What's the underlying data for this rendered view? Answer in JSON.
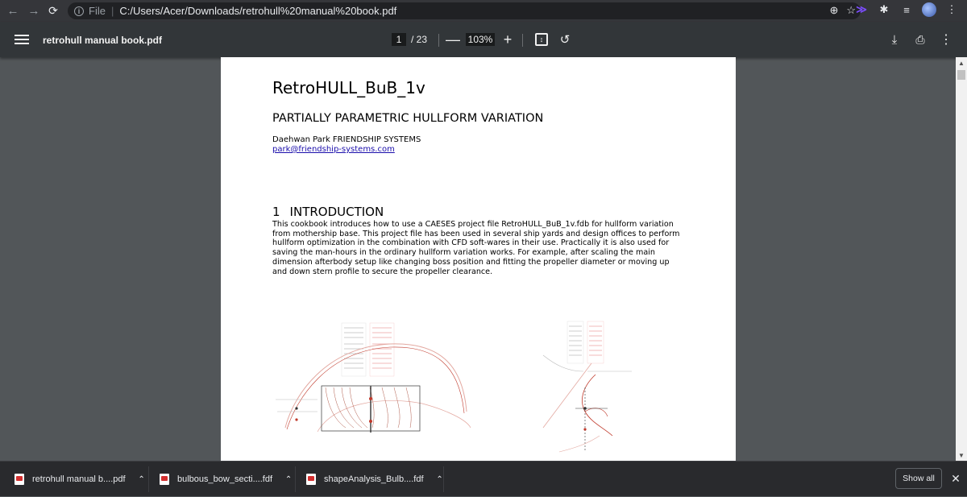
{
  "browser": {
    "url_scheme": "File",
    "url": "C:/Users/Acer/Downloads/retrohull%20manual%20book.pdf",
    "icons": [
      "back-icon",
      "forward-icon",
      "reload-icon",
      "info-icon",
      "zoom-icon",
      "star-icon",
      "extension-icon",
      "puzzle-icon",
      "playlist-icon",
      "profile-avatar",
      "kebab-menu-icon"
    ]
  },
  "pdf_toolbar": {
    "title": "retrohull manual book.pdf",
    "page_current": "1",
    "page_total": "/ 23",
    "zoom_out": "—",
    "zoom": "103%",
    "zoom_in": "+"
  },
  "document": {
    "title": "RetroHULL_BuB_1v",
    "subtitle": "PARTIALLY PARAMETRIC HULLFORM VARIATION",
    "author": "Daehwan Park FRIENDSHIP SYSTEMS",
    "email": "park@friendship-systems.com",
    "section_number": "1",
    "section_title": "INTRODUCTION",
    "intro_lines": [
      "This cookbook introduces how to use a CAESES project file RetroHULL_BuB_1v.fdb for hullform variation",
      "from mothership base. This project file has been used in several ship yards and design offices to perform",
      "hullform optimization in the combination with CFD soft-wares in their use. Practically it is also used for",
      "saving the man-hours in the ordinary hullform variation works. For example, after scaling the main",
      "dimension afterbody setup like changing boss position and fitting the propeller diameter or moving up",
      "and down stern profile to secure the propeller clearance."
    ]
  },
  "downloads": {
    "items": [
      {
        "label": "retrohull manual b....pdf"
      },
      {
        "label": "bulbous_bow_secti....fdf"
      },
      {
        "label": "shapeAnalysis_Bulb....fdf"
      }
    ],
    "show_all": "Show all",
    "close": "✕"
  },
  "colors": {
    "toolbar_bg": "#323639",
    "viewer_bg": "#525659",
    "link": "#1a0dab",
    "curve_red": "#c0392b"
  }
}
